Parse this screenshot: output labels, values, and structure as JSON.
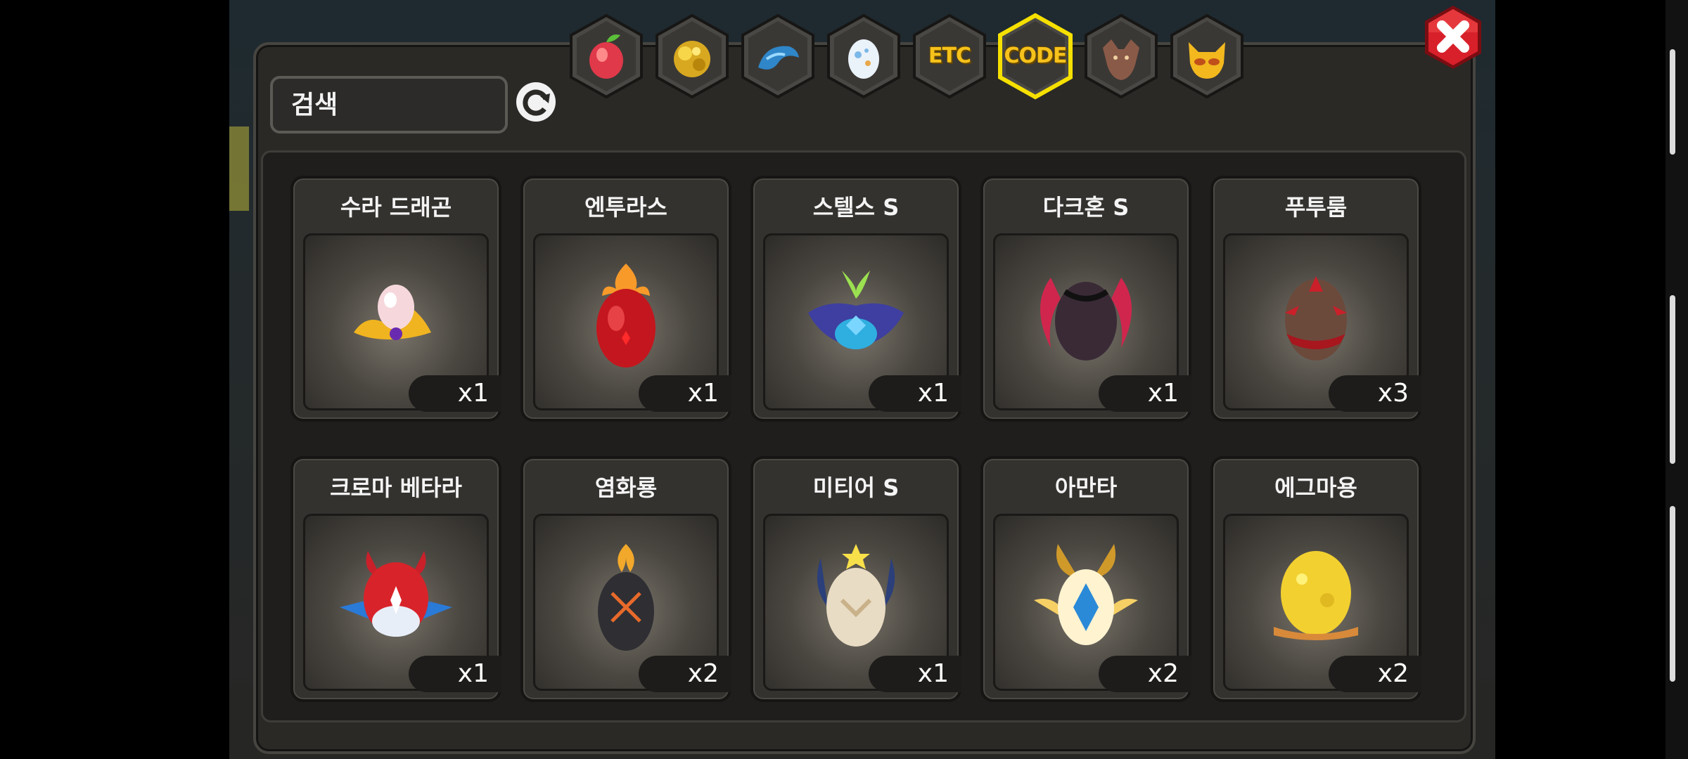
{
  "search": {
    "placeholder": "검색"
  },
  "tabs": [
    {
      "id": "fruit",
      "icon": "fruit-icon",
      "label": "",
      "active": false
    },
    {
      "id": "gold",
      "icon": "gold-ore-icon",
      "label": "",
      "active": false
    },
    {
      "id": "dragon",
      "icon": "blue-dragon-icon",
      "label": "",
      "active": false
    },
    {
      "id": "egg",
      "icon": "egg-icon",
      "label": "",
      "active": false
    },
    {
      "id": "etc",
      "icon": "etc-icon",
      "label": "ETC",
      "active": false
    },
    {
      "id": "code",
      "icon": "code-icon",
      "label": "CODE",
      "active": true
    },
    {
      "id": "beast",
      "icon": "beast-icon",
      "label": "",
      "active": false
    },
    {
      "id": "mask",
      "icon": "cat-mask-icon",
      "label": "",
      "active": false
    }
  ],
  "items": [
    {
      "name": "수라 드래곤",
      "count": "x1",
      "icon": "sura-dragon-egg-icon",
      "color": "#f0c040"
    },
    {
      "name": "엔투라스",
      "count": "x1",
      "icon": "enturas-egg-icon",
      "color": "#e03b2a"
    },
    {
      "name": "스텔스 S",
      "count": "x1",
      "icon": "stealth-s-egg-icon",
      "color": "#3f4fb0"
    },
    {
      "name": "다크혼 S",
      "count": "x1",
      "icon": "darkhorn-s-egg-icon",
      "color": "#d0264d"
    },
    {
      "name": "푸투룸",
      "count": "x3",
      "icon": "futurum-egg-icon",
      "color": "#6a4a3c"
    },
    {
      "name": "크로마 베타라",
      "count": "x1",
      "icon": "chroma-betara-egg-icon",
      "color": "#d8232a"
    },
    {
      "name": "염화룡",
      "count": "x2",
      "icon": "yeomhwa-dragon-egg-icon",
      "color": "#2e2e33"
    },
    {
      "name": "미티어 S",
      "count": "x1",
      "icon": "meteor-s-egg-icon",
      "color": "#e9dcc4"
    },
    {
      "name": "아만타",
      "count": "x2",
      "icon": "amanta-egg-icon",
      "color": "#f0c23a"
    },
    {
      "name": "에그마용",
      "count": "x2",
      "icon": "eggmayong-egg-icon",
      "color": "#f2d030"
    }
  ],
  "colors": {
    "accent": "#f6e000",
    "close": "#d8202a"
  }
}
